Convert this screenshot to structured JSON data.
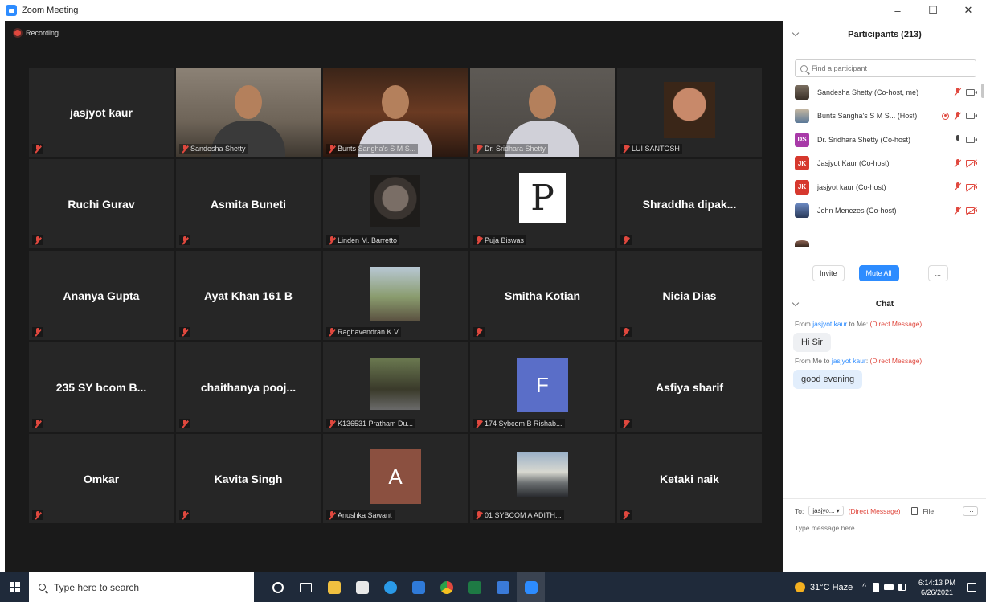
{
  "window": {
    "title": "Zoom Meeting",
    "controls": [
      "–",
      "☐",
      "✕"
    ]
  },
  "meeting": {
    "recording_label": "Recording",
    "tiles": [
      {
        "name": "jasjyot kaur",
        "display": "name",
        "label": ""
      },
      {
        "name": "Sandesha Shetty",
        "display": "video1",
        "label": "Sandesha Shetty"
      },
      {
        "name": "Bunts Sangha's S M S...",
        "display": "video2",
        "label": "Bunts Sangha's S M S..."
      },
      {
        "name": "Dr. Sridhara Shetty",
        "display": "video3",
        "label": "Dr. Sridhara Shetty",
        "active": true
      },
      {
        "name": "LUI SANTOSH",
        "display": "img-lui",
        "label": "LUI SANTOSH"
      },
      {
        "name": "Ruchi Gurav",
        "display": "name",
        "label": ""
      },
      {
        "name": "Asmita Buneti",
        "display": "name",
        "label": ""
      },
      {
        "name": "Linden M. Barretto",
        "display": "img-warrior",
        "label": "Linden M. Barretto"
      },
      {
        "name": "Puja Biswas",
        "display": "img-p",
        "label": "Puja Biswas",
        "letter": "P"
      },
      {
        "name": "Shraddha dipak...",
        "display": "name",
        "label": ""
      },
      {
        "name": "Ananya Gupta",
        "display": "name",
        "label": ""
      },
      {
        "name": "Ayat Khan 161 B",
        "display": "name",
        "label": ""
      },
      {
        "name": "Raghavendran K V",
        "display": "img-raghav",
        "label": "Raghavendran K V"
      },
      {
        "name": "Smitha Kotian",
        "display": "name",
        "label": ""
      },
      {
        "name": "Nicia Dias",
        "display": "name",
        "label": ""
      },
      {
        "name": "235 SY bcom B...",
        "display": "name",
        "label": ""
      },
      {
        "name": "chaithanya pooj...",
        "display": "name",
        "label": ""
      },
      {
        "name": "K136531 Pratham Du...",
        "display": "img-pratham",
        "label": "K136531 Pratham Du..."
      },
      {
        "name": "174 Sybcom B Rishab...",
        "display": "av-f",
        "label": "174 Sybcom B Rishab...",
        "letter": "F"
      },
      {
        "name": "Asfiya sharif",
        "display": "name",
        "label": ""
      },
      {
        "name": "Omkar",
        "display": "name",
        "label": ""
      },
      {
        "name": "Kavita Singh",
        "display": "name",
        "label": ""
      },
      {
        "name": "Anushka Sawant",
        "display": "av-a",
        "label": "Anushka Sawant",
        "letter": "A"
      },
      {
        "name": "01 SYBCOM A ADITH...",
        "display": "img-sunset",
        "label": "01 SYBCOM A ADITH..."
      },
      {
        "name": "Ketaki naik",
        "display": "name",
        "label": ""
      }
    ]
  },
  "participants": {
    "title": "Participants (213)",
    "search_placeholder": "Find a participant",
    "list": [
      {
        "name": "Sandesha Shetty (Co-host, me)",
        "avatar": "img1",
        "initials": "",
        "mic": "muted",
        "cam": "on",
        "rec": false
      },
      {
        "name": "Bunts Sangha's S M S...  (Host)",
        "avatar": "img2",
        "initials": "",
        "mic": "muted",
        "cam": "on",
        "rec": true
      },
      {
        "name": "Dr. Sridhara Shetty (Co-host)",
        "avatar": "ds",
        "initials": "DS",
        "mic": "on",
        "cam": "on",
        "rec": false
      },
      {
        "name": "Jasjyot Kaur (Co-host)",
        "avatar": "jk",
        "initials": "JK",
        "mic": "muted",
        "cam": "off",
        "rec": false
      },
      {
        "name": "jasjyot kaur (Co-host)",
        "avatar": "jk",
        "initials": "JK",
        "mic": "muted",
        "cam": "off",
        "rec": false
      },
      {
        "name": "John Menezes (Co-host)",
        "avatar": "img3",
        "initials": "",
        "mic": "muted",
        "cam": "off",
        "rec": false
      },
      {
        "name": "",
        "avatar": "img4",
        "initials": "",
        "mic": "none",
        "cam": "none",
        "rec": false
      }
    ],
    "invite_label": "Invite",
    "mute_all_label": "Mute All",
    "more_label": "..."
  },
  "chat": {
    "title": "Chat",
    "messages": [
      {
        "prefix": "From ",
        "from": "jasjyot kaur",
        "middle": " to Me: ",
        "dm": "(Direct Message)",
        "text": "Hi Sir",
        "mine": false
      },
      {
        "prefix": "From Me to ",
        "from": "jasjyot kaur",
        "middle": ": ",
        "dm": "(Direct Message)",
        "text": "good evening",
        "mine": true
      }
    ],
    "to_label": "To:",
    "to_value": "jasjyo... ▾",
    "to_dm": "(Direct Message)",
    "file_label": "File",
    "more_label": "···",
    "input_placeholder": "Type message here..."
  },
  "taskbar": {
    "search_placeholder": "Type here to search",
    "weather": "31°C  Haze",
    "chevron": "^",
    "time": "6:14:13 PM",
    "date": "6/26/2021"
  }
}
